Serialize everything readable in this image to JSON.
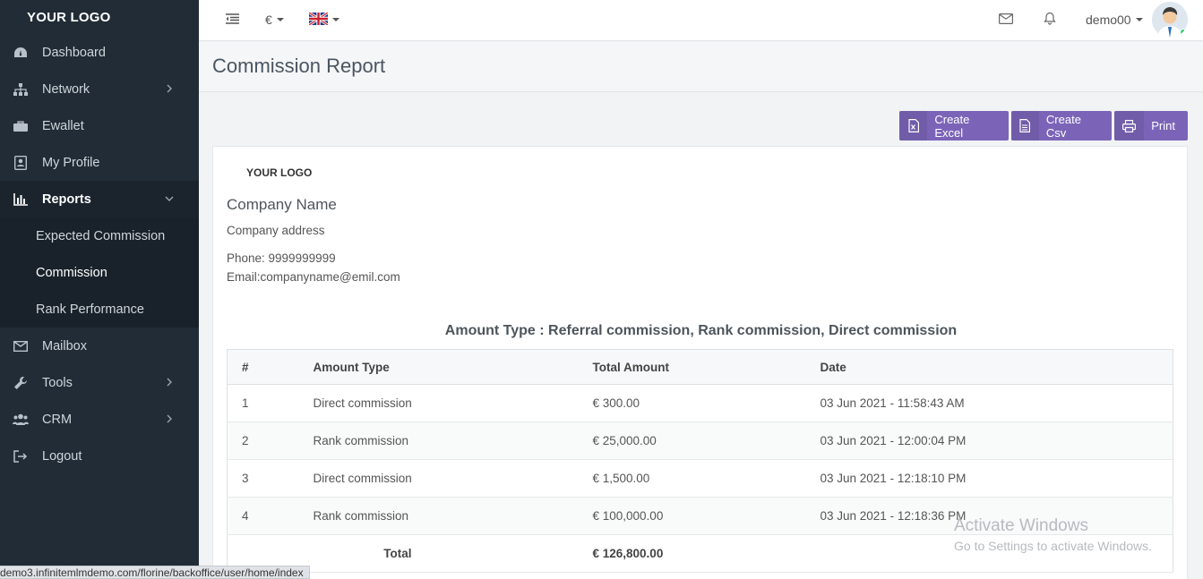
{
  "sidebar": {
    "logo": "YOUR LOGO",
    "items": [
      {
        "label": "Dashboard",
        "icon": "dashboard-icon"
      },
      {
        "label": "Network",
        "icon": "sitemap-icon"
      },
      {
        "label": "Ewallet",
        "icon": "briefcase-icon"
      },
      {
        "label": "My Profile",
        "icon": "profile-icon"
      },
      {
        "label": "Reports",
        "icon": "bar-chart-icon"
      },
      {
        "label": "Mailbox",
        "icon": "envelope-icon"
      },
      {
        "label": "Tools",
        "icon": "wrench-icon"
      },
      {
        "label": "CRM",
        "icon": "users-icon"
      },
      {
        "label": "Logout",
        "icon": "logout-icon"
      }
    ],
    "reports_sub": [
      {
        "label": "Expected Commission"
      },
      {
        "label": "Commission"
      },
      {
        "label": "Rank Performance"
      }
    ]
  },
  "topbar": {
    "currency": "€",
    "user": "demo00"
  },
  "page": {
    "title": "Commission Report"
  },
  "actions": {
    "excel": "Create Excel",
    "csv": "Create Csv",
    "print": "Print"
  },
  "report": {
    "logo": "YOUR LOGO",
    "company_name": "Company Name",
    "company_address": "Company address",
    "phone": "Phone: 9999999999",
    "email": "Email:companyname@emil.com",
    "amount_type": "Amount Type : Referral commission, Rank commission, Direct commission",
    "columns": [
      "#",
      "Amount Type",
      "Total Amount",
      "Date"
    ],
    "rows": [
      [
        "1",
        "Direct commission",
        "€ 300.00",
        "03 Jun 2021 - 11:58:43 AM"
      ],
      [
        "2",
        "Rank commission",
        "€ 25,000.00",
        "03 Jun 2021 - 12:00:04 PM"
      ],
      [
        "3",
        "Direct commission",
        "€ 1,500.00",
        "03 Jun 2021 - 12:18:10 PM"
      ],
      [
        "4",
        "Rank commission",
        "€ 100,000.00",
        "03 Jun 2021 - 12:18:36 PM"
      ]
    ],
    "total_label": "Total",
    "total_value": "€ 126,800.00"
  },
  "watermark": {
    "line1": "Activate Windows",
    "line2": "Go to Settings to activate Windows."
  },
  "status_bar": {
    "url": "demo3.infinitemlmdemo.com/florine/backoffice/user/home/index"
  },
  "colors": {
    "sidebar_bg": "#212c36",
    "accent": "#7b64b8",
    "online": "#2ecc71"
  }
}
